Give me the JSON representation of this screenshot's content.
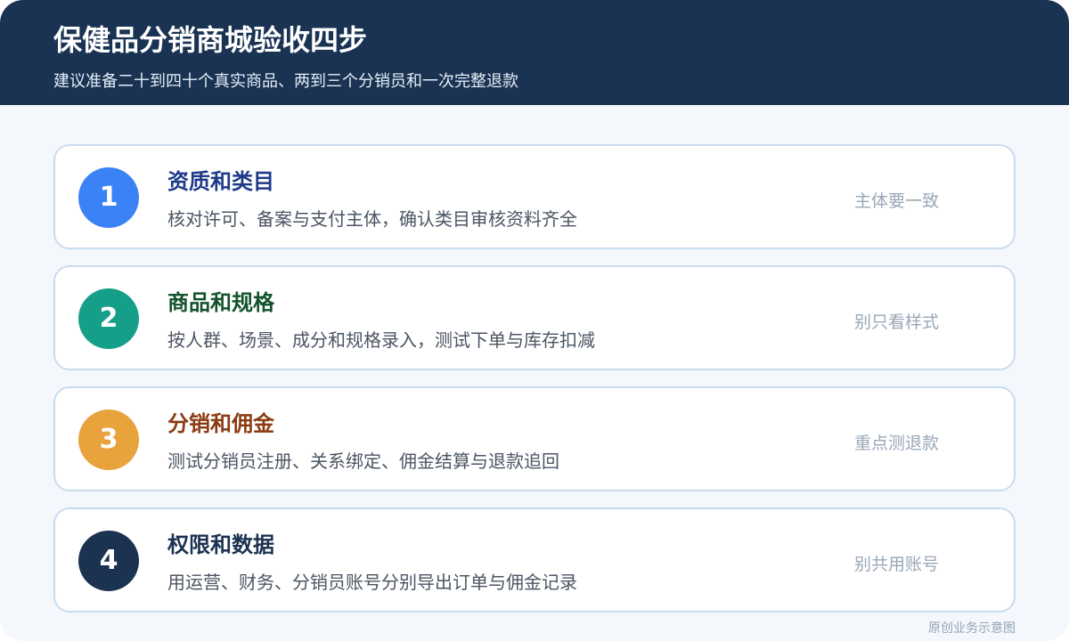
{
  "header": {
    "title": "保健品分销商城验收四步",
    "subtitle": "建议准备二十到四十个真实商品、两到三个分销员和一次完整退款"
  },
  "steps": [
    {
      "number": "1",
      "title": "资质和类目",
      "description": "核对许可、备案与支付主体，确认类目审核资料齐全",
      "note": "主体要一致",
      "circle_color": "#3b82f6",
      "title_color": "#1e3a8a"
    },
    {
      "number": "2",
      "title": "商品和规格",
      "description": "按人群、场景、成分和规格录入，测试下单与库存扣减",
      "note": "别只看样式",
      "circle_color": "#159f88",
      "title_color": "#14532d"
    },
    {
      "number": "3",
      "title": "分销和佣金",
      "description": "测试分销员注册、关系绑定、佣金结算与退款追回",
      "note": "重点测退款",
      "circle_color": "#e8a33d",
      "title_color": "#8a3b12"
    },
    {
      "number": "4",
      "title": "权限和数据",
      "description": "用运营、财务、分销员账号分别导出订单与佣金记录",
      "note": "别共用账号",
      "circle_color": "#1b3250",
      "title_color": "#1b3250"
    }
  ],
  "footer": {
    "note": "原创业务示意图"
  }
}
